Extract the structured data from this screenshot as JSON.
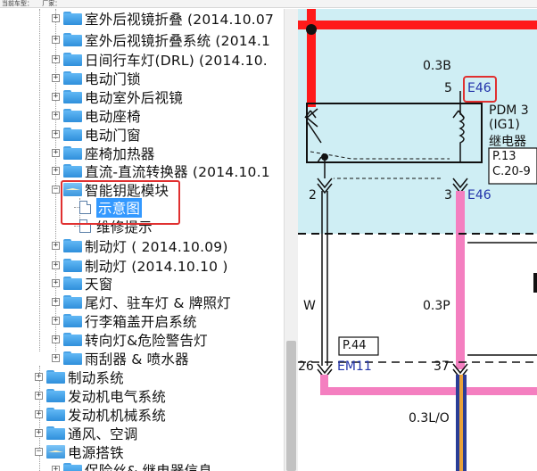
{
  "topbar": {
    "vehicle_label": "当前车型：",
    "maker_label": "厂家："
  },
  "tree": {
    "items": [
      {
        "label": "室外后视镜折叠 (2014.10.07"
      },
      {
        "label": "室外后视镜折叠系统 (2014.1"
      },
      {
        "label": "日间行车灯(DRL) (2014.10."
      },
      {
        "label": "电动门锁"
      },
      {
        "label": "电动室外后视镜"
      },
      {
        "label": "电动座椅"
      },
      {
        "label": "电动门窗"
      },
      {
        "label": "座椅加热器"
      },
      {
        "label": "直流-直流转换器 (2014.10.1"
      },
      {
        "label": "智能钥匙模块"
      },
      {
        "label": "示意图"
      },
      {
        "label": "维修提示"
      },
      {
        "label": "制动灯 ( 2014.10.09)"
      },
      {
        "label": "制动灯 (2014.10.10 )"
      },
      {
        "label": "天窗"
      },
      {
        "label": "尾灯、驻车灯 & 牌照灯"
      },
      {
        "label": "行李箱盖开启系统"
      },
      {
        "label": "转向灯&危险警告灯"
      },
      {
        "label": "雨刮器 & 喷水器"
      },
      {
        "label": "制动系统"
      },
      {
        "label": "发动机电气系统"
      },
      {
        "label": "发动机机械系统"
      },
      {
        "label": "通风、空调"
      },
      {
        "label": "电源搭铁"
      },
      {
        "label": "保险丝& 继电器信息"
      }
    ]
  },
  "diagram": {
    "wire_top_label": "0.3B",
    "pin_5": "5",
    "connector_e46_top": "E46",
    "relay_name": "PDM 3",
    "relay_sub": "(IG1)",
    "relay_cn": "继电器",
    "page_ref_1": "P.13",
    "page_ref_2": "C.20-9",
    "pin_2": "2",
    "pin_3": "3",
    "connector_e46_bottom": "E46",
    "wire_w": "W",
    "wire_03p": "0.3P",
    "page_ref_3": "P.44",
    "pin_26": "26",
    "connector_em11": "EM11",
    "pin_37": "37",
    "wire_03lo": "0.3L/O",
    "colors": {
      "red_wire": "#ff1a1a",
      "pink_wire": "#f47fc0",
      "highlight": "#cfeef4",
      "connector": "#2233aa",
      "callout": "#e03030"
    }
  }
}
